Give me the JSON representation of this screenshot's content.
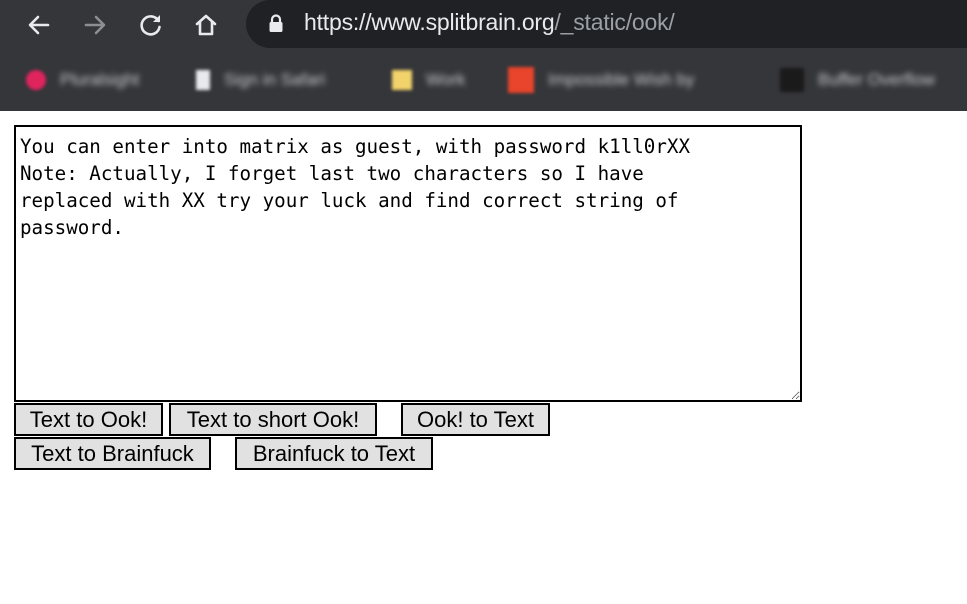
{
  "browser": {
    "url_host": "https://www.splitbrain.org",
    "url_path": "/_static/ook/",
    "bookmarks": [
      {
        "label": "Pluralsight",
        "icon": "pluralsight-icon",
        "color": "#e0245e"
      },
      {
        "label": "Sign in Safari",
        "icon": "page-icon",
        "color": "#e8eaed"
      },
      {
        "label": "Work",
        "icon": "folder-icon",
        "color": "#f2d36b"
      },
      {
        "label": "Impossible Wish by",
        "icon": "site-icon",
        "color": "#e8452c"
      },
      {
        "label": "Buffer Overflow",
        "icon": "site-dark-icon",
        "color": "#1a1a1a"
      }
    ]
  },
  "editor": {
    "text": "You can enter into matrix as guest, with password k1ll0rXX\nNote: Actually, I forget last two characters so I have\nreplaced with XX try your luck and find correct string of\npassword."
  },
  "buttons": {
    "text_to_ook": "Text to Ook!",
    "text_to_short_ook": "Text to short Ook!",
    "ook_to_text": "Ook! to Text",
    "text_to_brainfuck": "Text to Brainfuck",
    "brainfuck_to_text": "Brainfuck to Text"
  }
}
